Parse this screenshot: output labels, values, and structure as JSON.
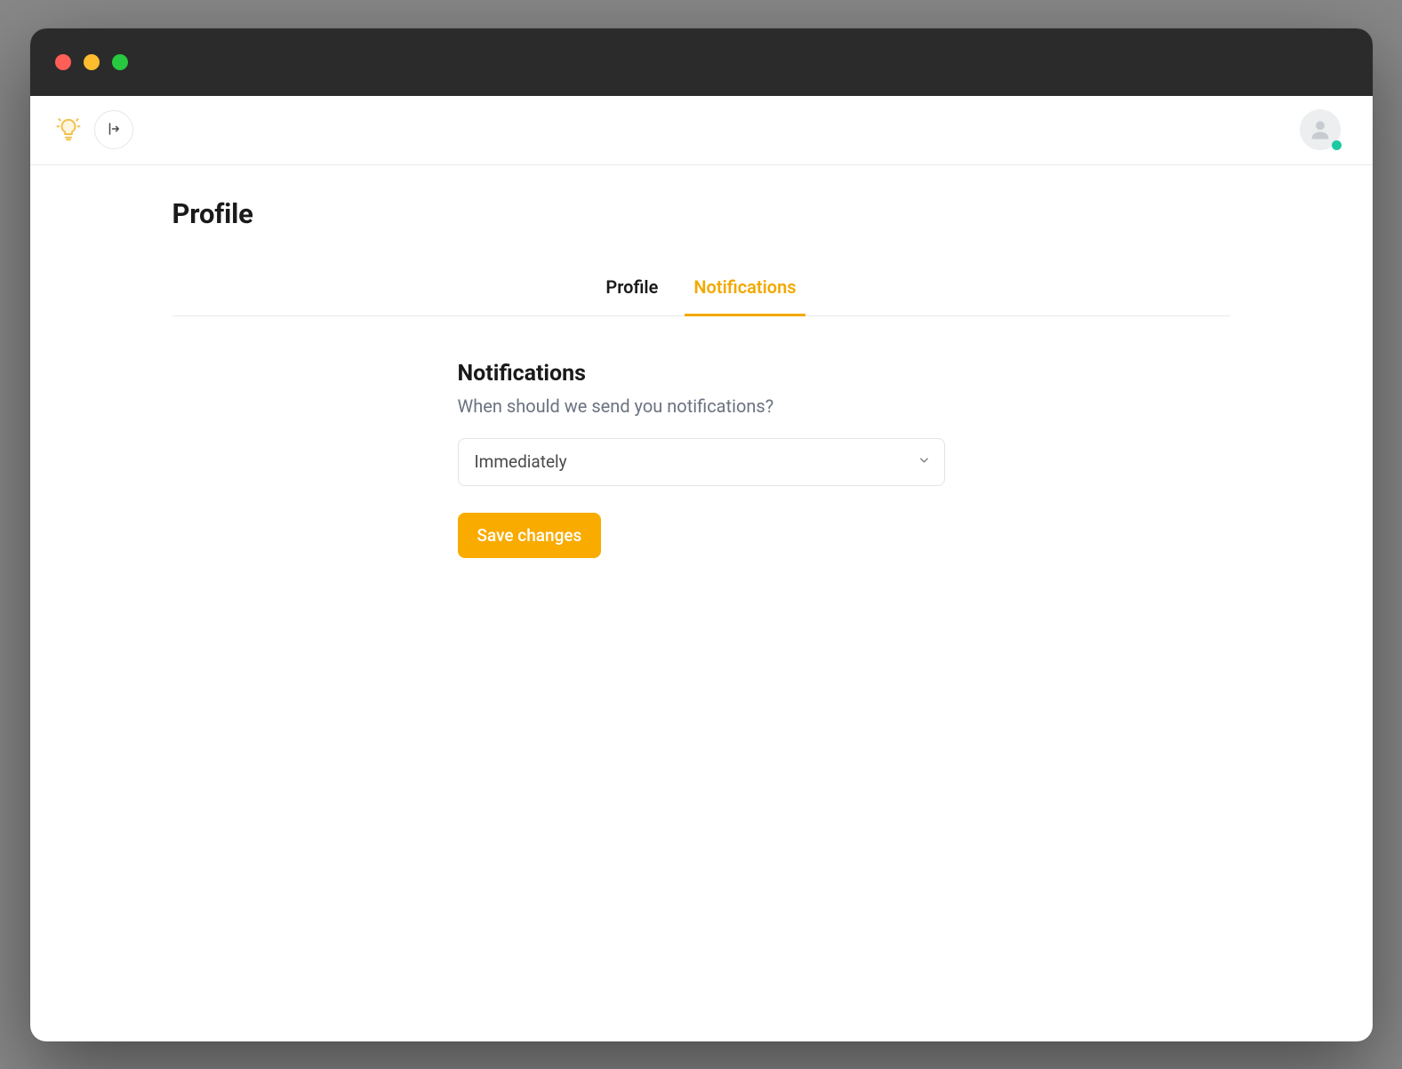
{
  "colors": {
    "accent": "#f2a900",
    "buttonBg": "#f9ab00",
    "statusOnline": "#1dc9a0"
  },
  "header": {
    "pageTitle": "Profile"
  },
  "tabs": [
    {
      "id": "profile",
      "label": "Profile",
      "active": false
    },
    {
      "id": "notifications",
      "label": "Notifications",
      "active": true
    }
  ],
  "notifications": {
    "sectionTitle": "Notifications",
    "description": "When should we send you notifications?",
    "select": {
      "value": "Immediately"
    },
    "saveLabel": "Save changes"
  },
  "icons": {
    "logo": "lightbulb-icon",
    "sidebarToggle": "sidebar-expand-icon",
    "avatar": "person-icon",
    "chevron": "chevron-down-icon"
  }
}
